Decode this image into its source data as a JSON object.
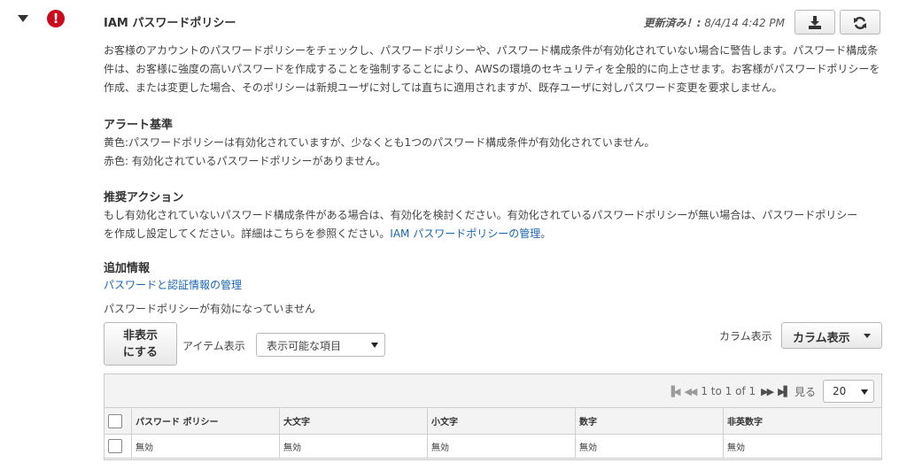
{
  "check": {
    "title": "IAM パスワードポリシー",
    "updated_label": "更新済み！:",
    "updated_time": "8/4/14 4:42 PM",
    "description": "お客様のアカウントのパスワードポリシーをチェックし、パスワードポリシーや、パスワード構成条件が有効化されていない場合に警告します。パスワード構成条件は、お客様に強度の高いパスワードを作成することを強制することにより、AWSの環境のセキュリティを全般的に向上させます。お客様がパスワードポリシーを作成、または変更した場合、そのポリシーは新規ユーザに対しては直ちに適用されますが、既存ユーザに対しパスワード変更を要求しません。"
  },
  "alert_criteria": {
    "heading": "アラート基準",
    "yellow": "黄色:パスワードポリシーは有効化されていますが、少なくとも1つのパスワード構成条件が有効化されていません。",
    "red": "赤色: 有効化されているパスワードポリシーがありません。"
  },
  "recommended_action": {
    "heading": "推奨アクション",
    "line1": "もし有効化されていないパスワード構成条件がある場合は、有効化を検討ください。有効化されているパスワードポリシーが無い場合は、パスワードポリシー",
    "line2": "を作成し設定してください。詳細はこちらを参照ください。",
    "link": "IAM パスワードポリシーの管理",
    "after_link": "。"
  },
  "additional_info": {
    "heading": "追加情報",
    "link": "パスワードと認証情報の管理"
  },
  "status_text": "パスワードポリシーが有効になっていません",
  "toolbar": {
    "hide_line1": "非表示",
    "hide_line2": "にする",
    "item_label": "アイテム表示",
    "item_select": "表示可能な項目",
    "column_label": "カラム表示",
    "column_button": "カラム表示"
  },
  "pager": {
    "range": "1 to 1 of 1",
    "per_page_label": "見る",
    "per_page": "20"
  },
  "table": {
    "headers": [
      "パスワード ポリシー",
      "大文字",
      "小文字",
      "数字",
      "非英数字"
    ],
    "rows": [
      [
        "無効",
        "無効",
        "無効",
        "無効",
        "無効"
      ]
    ]
  },
  "icons": {
    "alert": "exclamation-circle-icon",
    "download": "download-icon",
    "refresh": "refresh-icon"
  },
  "colors": {
    "alert_red": "#cc0b1f",
    "link_blue": "#1a66b3"
  }
}
